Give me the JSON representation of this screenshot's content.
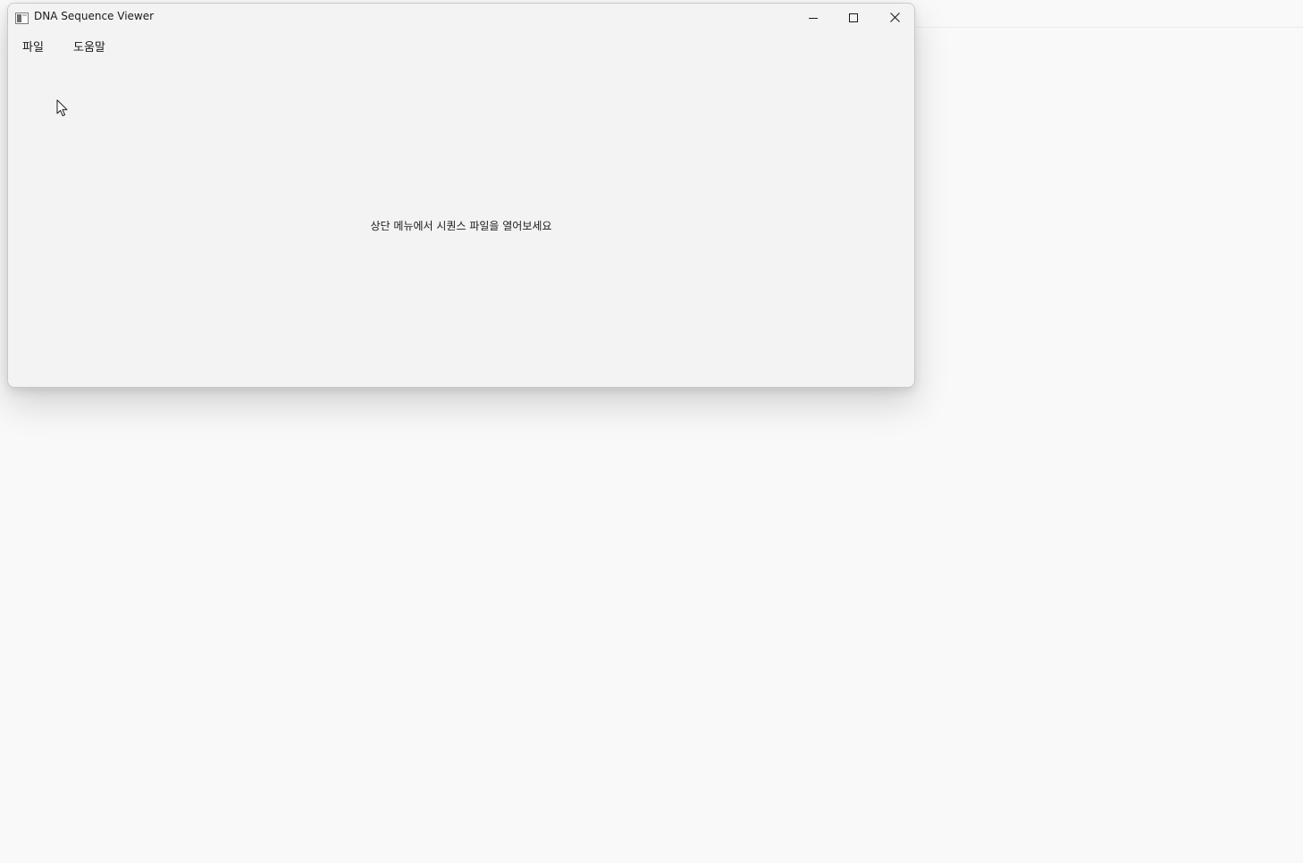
{
  "window": {
    "title": "DNA Sequence Viewer",
    "app_icon": "app-window-icon",
    "controls": {
      "minimize_icon": "minimize-icon",
      "maximize_icon": "maximize-icon",
      "close_icon": "close-icon"
    }
  },
  "menubar": {
    "items": [
      {
        "label": "파일"
      },
      {
        "label": "도움말"
      }
    ]
  },
  "main": {
    "placeholder": "상단 메뉴에서 시퀀스 파일을 열어보세요"
  },
  "cursor": {
    "icon": "mouse-pointer-icon"
  }
}
